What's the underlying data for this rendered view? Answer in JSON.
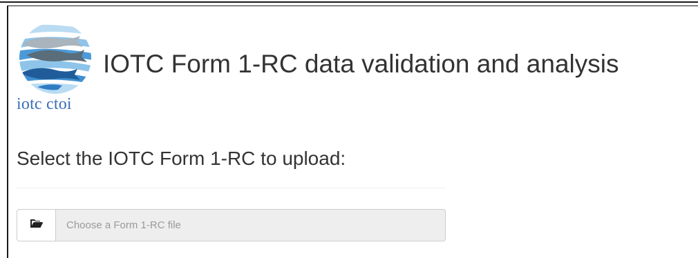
{
  "header": {
    "title": "IOTC Form 1-RC data validation and analysis",
    "logo": {
      "icon": "iotc-logo-icon",
      "text": "iotc ctoi",
      "colors": {
        "light_blue": "#8ec4ea",
        "mid_blue": "#3f8fd2",
        "dark_blue": "#1f5c99",
        "fish_dark": "#5a6d7a",
        "fish_gray": "#a9b4bc",
        "text": "#3a6fb8"
      }
    }
  },
  "upload": {
    "label": "Select the IOTC Form 1-RC to upload:",
    "browse_button_icon": "folder-open-icon",
    "placeholder": "Choose a Form 1-RC file"
  },
  "colors": {
    "text": "#333333",
    "input_bg": "#eeeeee",
    "input_border": "#cccccc",
    "placeholder": "#999999"
  }
}
